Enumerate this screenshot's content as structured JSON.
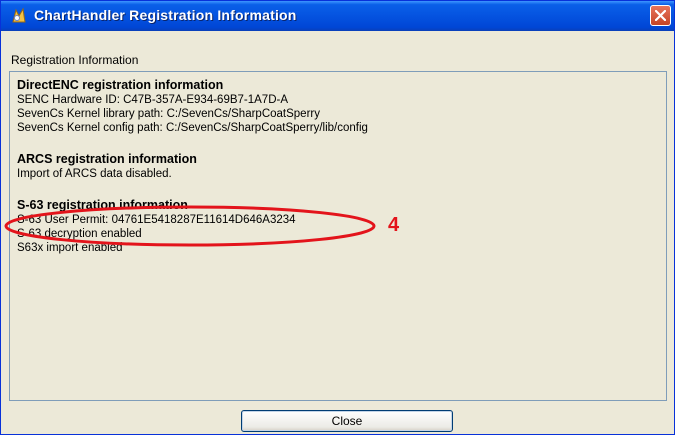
{
  "window": {
    "title": "ChartHandler Registration Information",
    "icon": "charthandler-app-icon",
    "close_icon": "close-icon",
    "accent_color": "#0553e0"
  },
  "group_label": "Registration Information",
  "sections": [
    {
      "title": "DirectENC registration information",
      "lines": [
        "SENC Hardware ID: C47B-357A-E934-69B7-1A7D-A",
        "SevenCs Kernel library path: C:/SevenCs/SharpCoatSperry",
        "SevenCs Kernel config path: C:/SevenCs/SharpCoatSperry/lib/config"
      ]
    },
    {
      "title": "ARCS registration information",
      "lines": [
        "Import of ARCS data disabled."
      ]
    },
    {
      "title": "S-63 registration information",
      "lines": [
        "S-63 User Permit: 04761E5418287E11614D646A3234",
        "S-63 decryption enabled",
        "S63x import enabled"
      ]
    }
  ],
  "close_button_label": "Close",
  "annotation": {
    "number": "4",
    "color": "#e3141b"
  }
}
